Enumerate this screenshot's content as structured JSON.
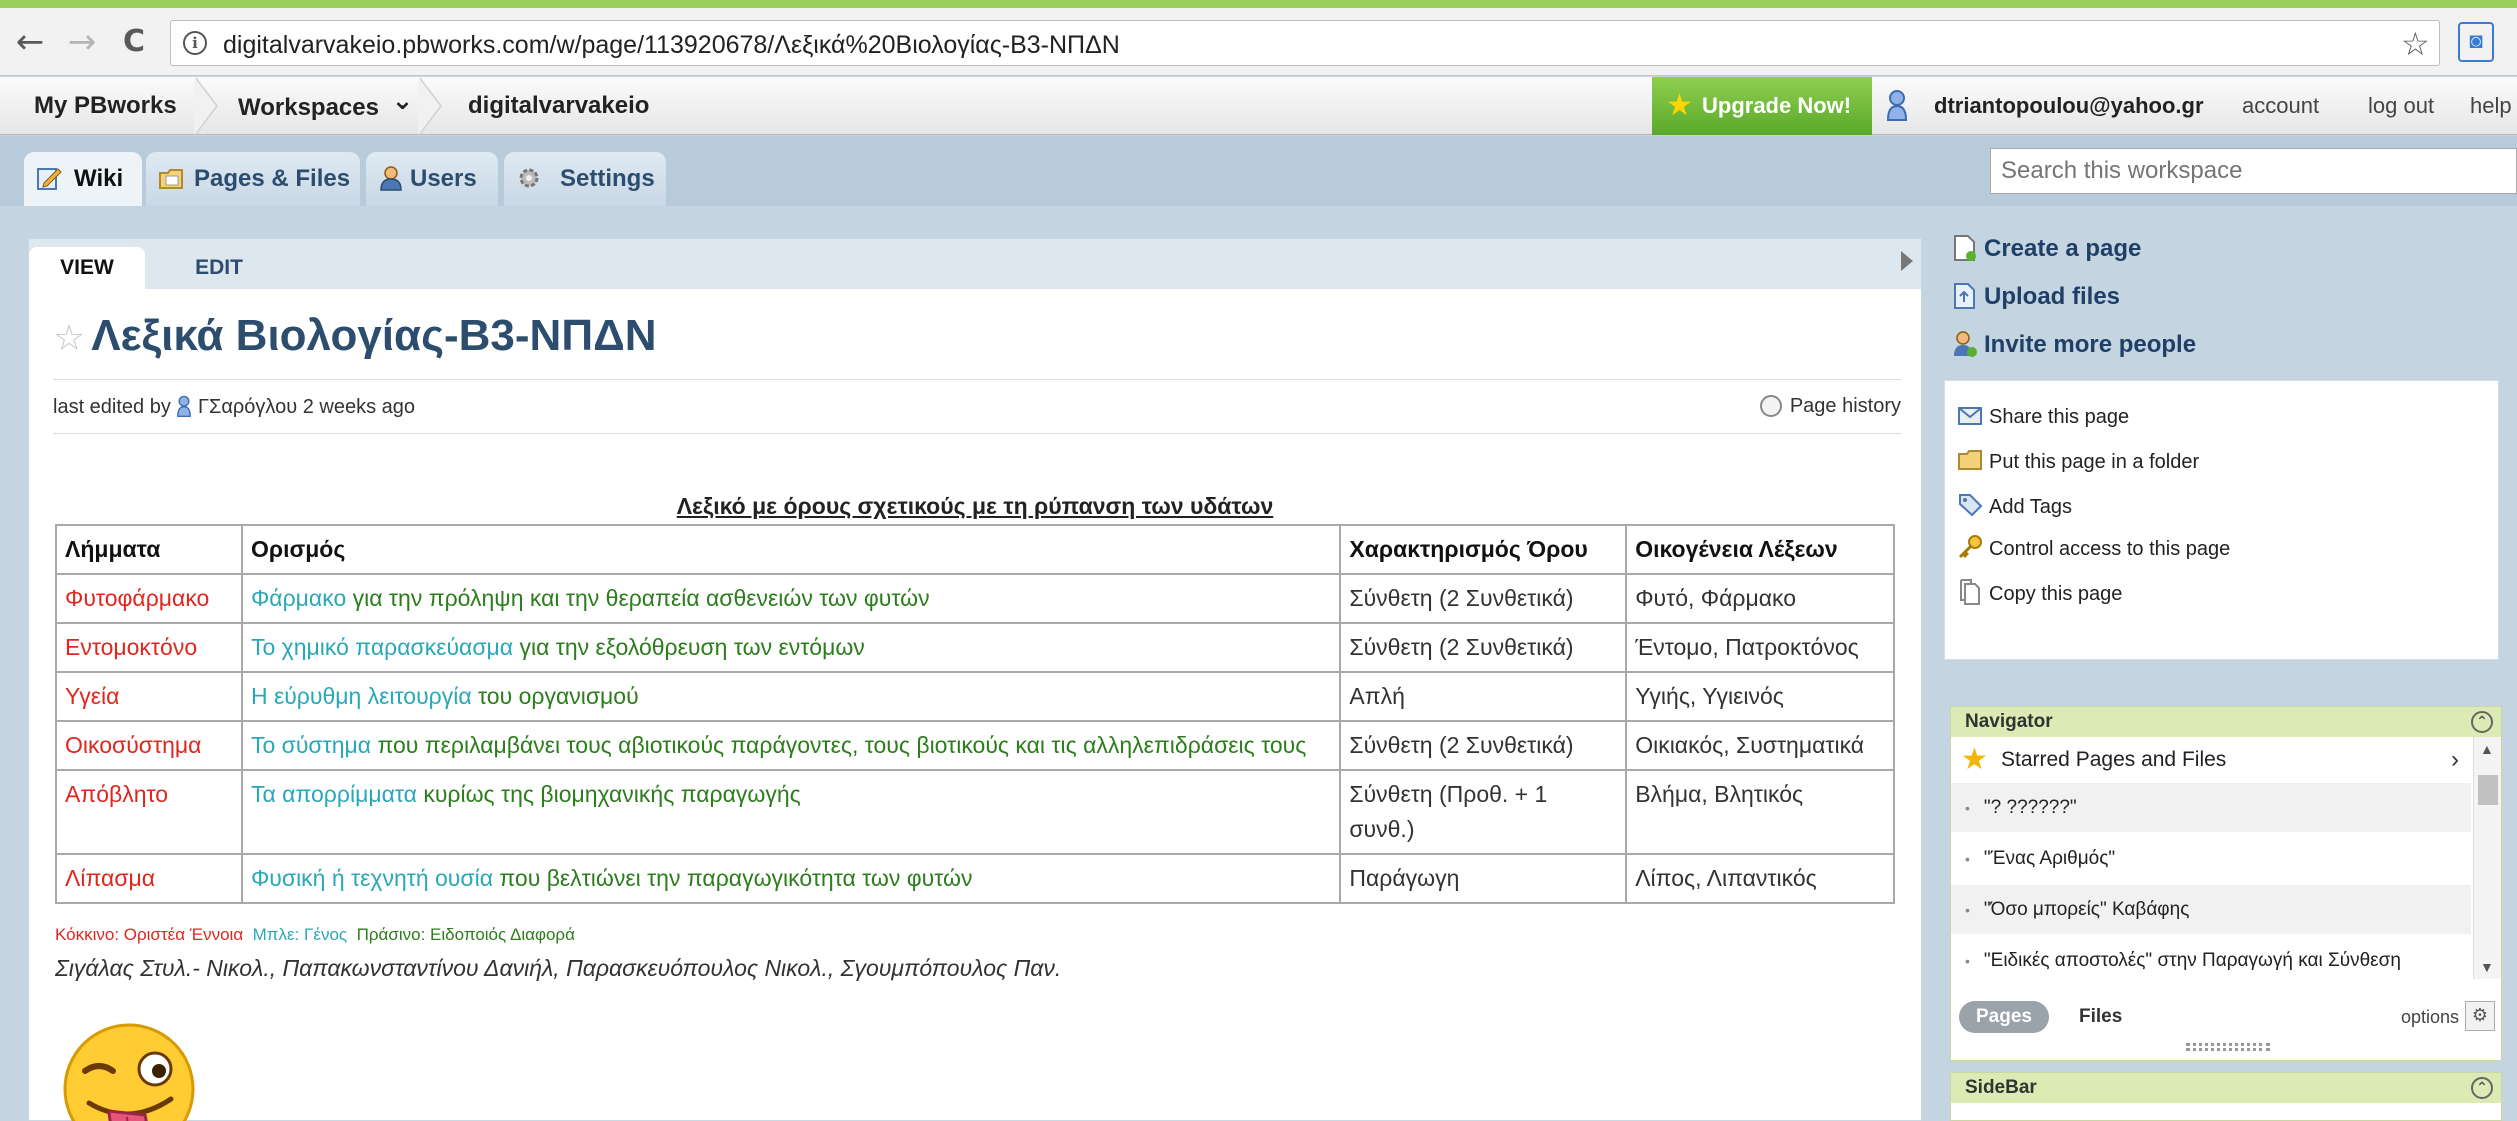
{
  "browser": {
    "url": "digitalvarvakeio.pbworks.com/w/page/113920678/Λεξικά%20Βιολογίας-Β3-ΝΠΔΝ",
    "back_glyph": "←",
    "forward_glyph": "→",
    "reload_glyph": "C",
    "info_glyph": "i",
    "star_glyph": "☆",
    "ext_glyph": "◙"
  },
  "top_nav": {
    "my_pbworks": "My PBworks",
    "workspaces": "Workspaces",
    "workspaces_chevron": "⌄",
    "workspace_name": "digitalvarvakeio",
    "upgrade": "Upgrade Now!",
    "upgrade_star": "★",
    "user_email": "dtriantopoulou@yahoo.gr",
    "account": "account",
    "logout": "log out",
    "help": "help"
  },
  "tabs": {
    "wiki": "Wiki",
    "pages_files": "Pages & Files",
    "users": "Users",
    "settings": "Settings"
  },
  "search": {
    "placeholder": "Search this workspace"
  },
  "page": {
    "view_tab": "VIEW",
    "edit_tab": "EDIT",
    "title_star": "☆",
    "title": "Λεξικά Βιολογίας-Β3-ΝΠΔΝ",
    "last_edited_prefix": "last edited by",
    "editor": "ΓΣαρόγλου",
    "edited_ago": "2 weeks ago",
    "page_history": "Page history",
    "table_title": "Λεξικό με όρους σχετικούς με τη ρύπανση των υδάτων",
    "table_headers": [
      "Λήμματα",
      "Ορισμός",
      "Χαρακτηρισμός Όρου",
      "Οικογένεια Λέξεων"
    ],
    "table_rows": [
      {
        "term": "Φυτοφάρμακο",
        "def_blue": "Φάρμακο",
        "def_green": " για την πρόληψη και την θεραπεία ασθενειών των φυτών",
        "type": "Σύνθετη (2 Συνθετικά)",
        "family": "Φυτό, Φάρμακο"
      },
      {
        "term": "Εντομοκτόνο",
        "def_blue": "Το χημικό παρασκεύασμα",
        "def_green": " για την εξολόθρευση των εντόμων",
        "type": "Σύνθετη (2 Συνθετικά)",
        "family": "Έντομο, Πατροκτόνος"
      },
      {
        "term": "Υγεία",
        "def_blue": "Η εύρυθμη λειτουργία",
        "def_green": " του οργανισμού",
        "type": "Απλή",
        "family": "Υγιής, Υγιεινός"
      },
      {
        "term": "Οικοσύστημα",
        "def_blue": "Το σύστημα",
        "def_green": " που περιλαμβάνει τους αβιοτικούς παράγοντες, τους βιοτικούς και τις αλληλεπιδράσεις τους",
        "type": "Σύνθετη (2 Συνθετικά)",
        "family": "Οικιακός, Συστηματικά"
      },
      {
        "term": "Απόβλητο",
        "def_blue": "Τα απορρίμματα",
        "def_green": " κυρίως της βιομηχανικής παραγωγής",
        "type": "Σύνθετη (Προθ. + 1 συνθ.)",
        "family": "Βλήμα, Βλητικός"
      },
      {
        "term": "Λίπασμα",
        "def_blue": "Φυσική ή τεχνητή ουσία",
        "def_green": " που βελτιώνει την παραγωγικότητα των φυτών",
        "type": "Παράγωγη",
        "family": "Λίπος, Λιπαντικός"
      }
    ],
    "legend_red": "Κόκκινο: Οριστέα Έννοια",
    "legend_blue": "Μπλε: Γένος",
    "legend_green": "Πράσινο: Ειδοποιός Διαφορά",
    "authors": "Σιγάλας Στυλ.- Νικολ., Παπακωνσταντίνου Δανιήλ, Παρασκευόπουλος Νικολ., Σγουμπόπουλος Παν."
  },
  "actions": {
    "create_page": "Create a page",
    "upload_files": "Upload files",
    "invite": "Invite more people",
    "share": "Share this page",
    "folder": "Put this page in a folder",
    "tags": "Add Tags",
    "access": "Control access to this page",
    "copy": "Copy this page"
  },
  "navigator": {
    "title": "Navigator",
    "toggle_glyph": "⌃",
    "starred": "Starred Pages and Files",
    "starred_chevron": "›",
    "items": [
      "\"? ??????\"",
      "\"Ένας Αριθμός\"",
      "\"Όσο μπορείς\" Καβάφης",
      "\"Ειδικές αποστολές\" στην Παραγωγή και Σύνθεση"
    ],
    "pages_tab": "Pages",
    "files_tab": "Files",
    "options": "options",
    "gear_glyph": "⚙"
  },
  "sidebar_widget": {
    "title": "SideBar"
  },
  "colors": {
    "term_red": "#e0271f",
    "genus_blue": "#2aa8b8",
    "difference_green": "#2c7d1c",
    "upgrade_green": "#5aa82a",
    "title_blue": "#2d4d6e"
  }
}
